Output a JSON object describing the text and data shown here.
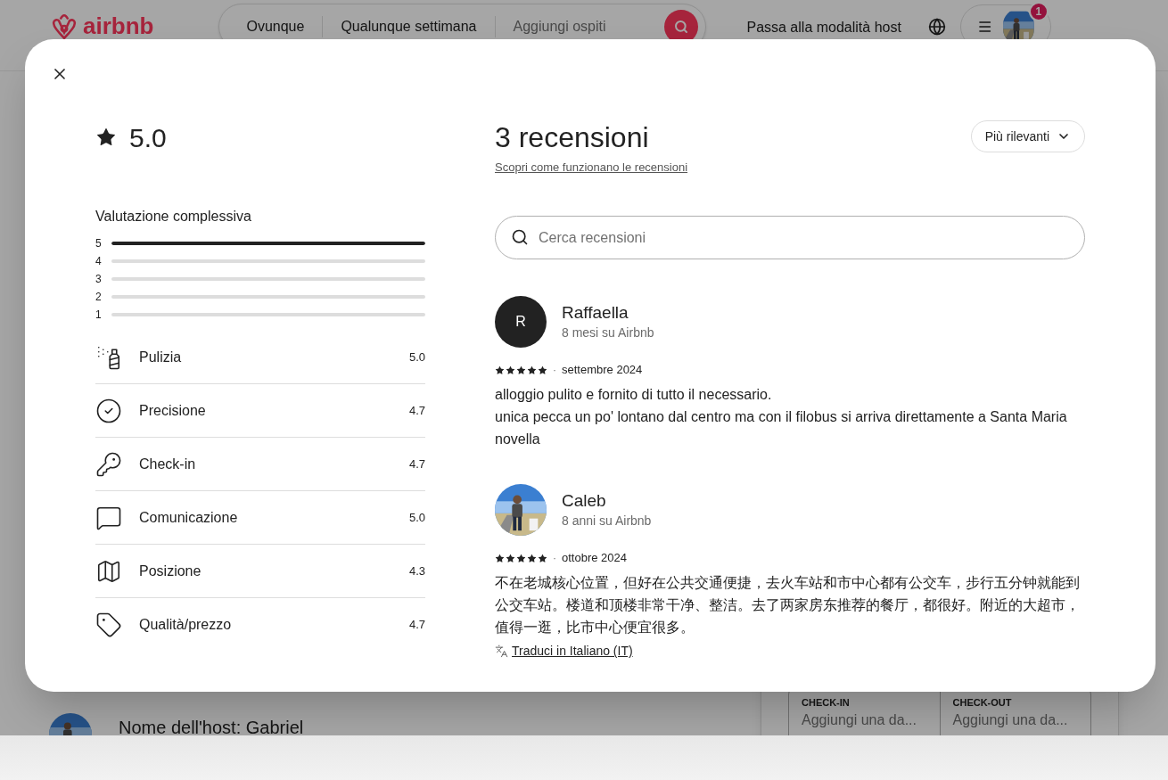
{
  "header": {
    "logo": "airbnb",
    "search": {
      "segments": [
        "Ovunque",
        "Qualunque settimana"
      ],
      "placeholder": "Aggiungi ospiti"
    },
    "host_mode": "Passa alla modalità host",
    "notification_badge": "1"
  },
  "listing": {
    "host": "Nome dell'host: Gabriel",
    "booking_fields": [
      {
        "label": "CHECK-IN",
        "placeholder": "Aggiungi una da..."
      },
      {
        "label": "CHECK-OUT",
        "placeholder": "Aggiungi una da..."
      }
    ]
  },
  "reviews_modal": {
    "rating": "5.0",
    "overall_title": "Valutazione complessiva",
    "distribution": [
      {
        "label": "5",
        "level": 1
      },
      {
        "label": "4",
        "level": 0
      },
      {
        "label": "3",
        "level": 0
      },
      {
        "label": "2",
        "level": 0
      },
      {
        "label": "1",
        "level": 0
      }
    ],
    "categories": [
      {
        "kind": "cleaning",
        "label": "Pulizia",
        "value": "5.0"
      },
      {
        "kind": "accuracy",
        "label": "Precisione",
        "value": "4.7"
      },
      {
        "kind": "checkin",
        "label": "Check-in",
        "value": "4.7"
      },
      {
        "kind": "communication",
        "label": "Comunicazione",
        "value": "5.0"
      },
      {
        "kind": "location",
        "label": "Posizione",
        "value": "4.3"
      },
      {
        "kind": "value",
        "label": "Qualità/prezzo",
        "value": "4.7"
      }
    ],
    "title": "3 recensioni",
    "help_link": "Scopri come funzionano le recensioni",
    "sort": "Più rilevanti",
    "search_placeholder": "Cerca recensioni",
    "reviews": [
      {
        "avatar": {
          "kind": "initial",
          "initial": "R"
        },
        "name": "Raffaella",
        "tenure": "8 mesi su Airbnb",
        "stars": 5,
        "separator": "·",
        "date": "settembre 2024",
        "text": "alloggio pulito e fornito di tutto il necessario.\nunica pecca un po' lontano dal centro ma con il filobus si arriva direttamente a Santa Maria novella"
      },
      {
        "name": "Caleb",
        "tenure": "8 anni su Airbnb",
        "stars": 5,
        "separator": "·",
        "date": "ottobre 2024",
        "text": "不在老城核心位置，但好在公共交通便捷，去火车站和市中心都有公交车，步行五分钟就能到公交车站。楼道和顶楼非常干净、整洁。去了两家房东推荐的餐厅，都很好。附近的大超市，值得一逛，比市中心便宜很多。",
        "translate": "Traduci in Italiano (IT)"
      }
    ]
  }
}
